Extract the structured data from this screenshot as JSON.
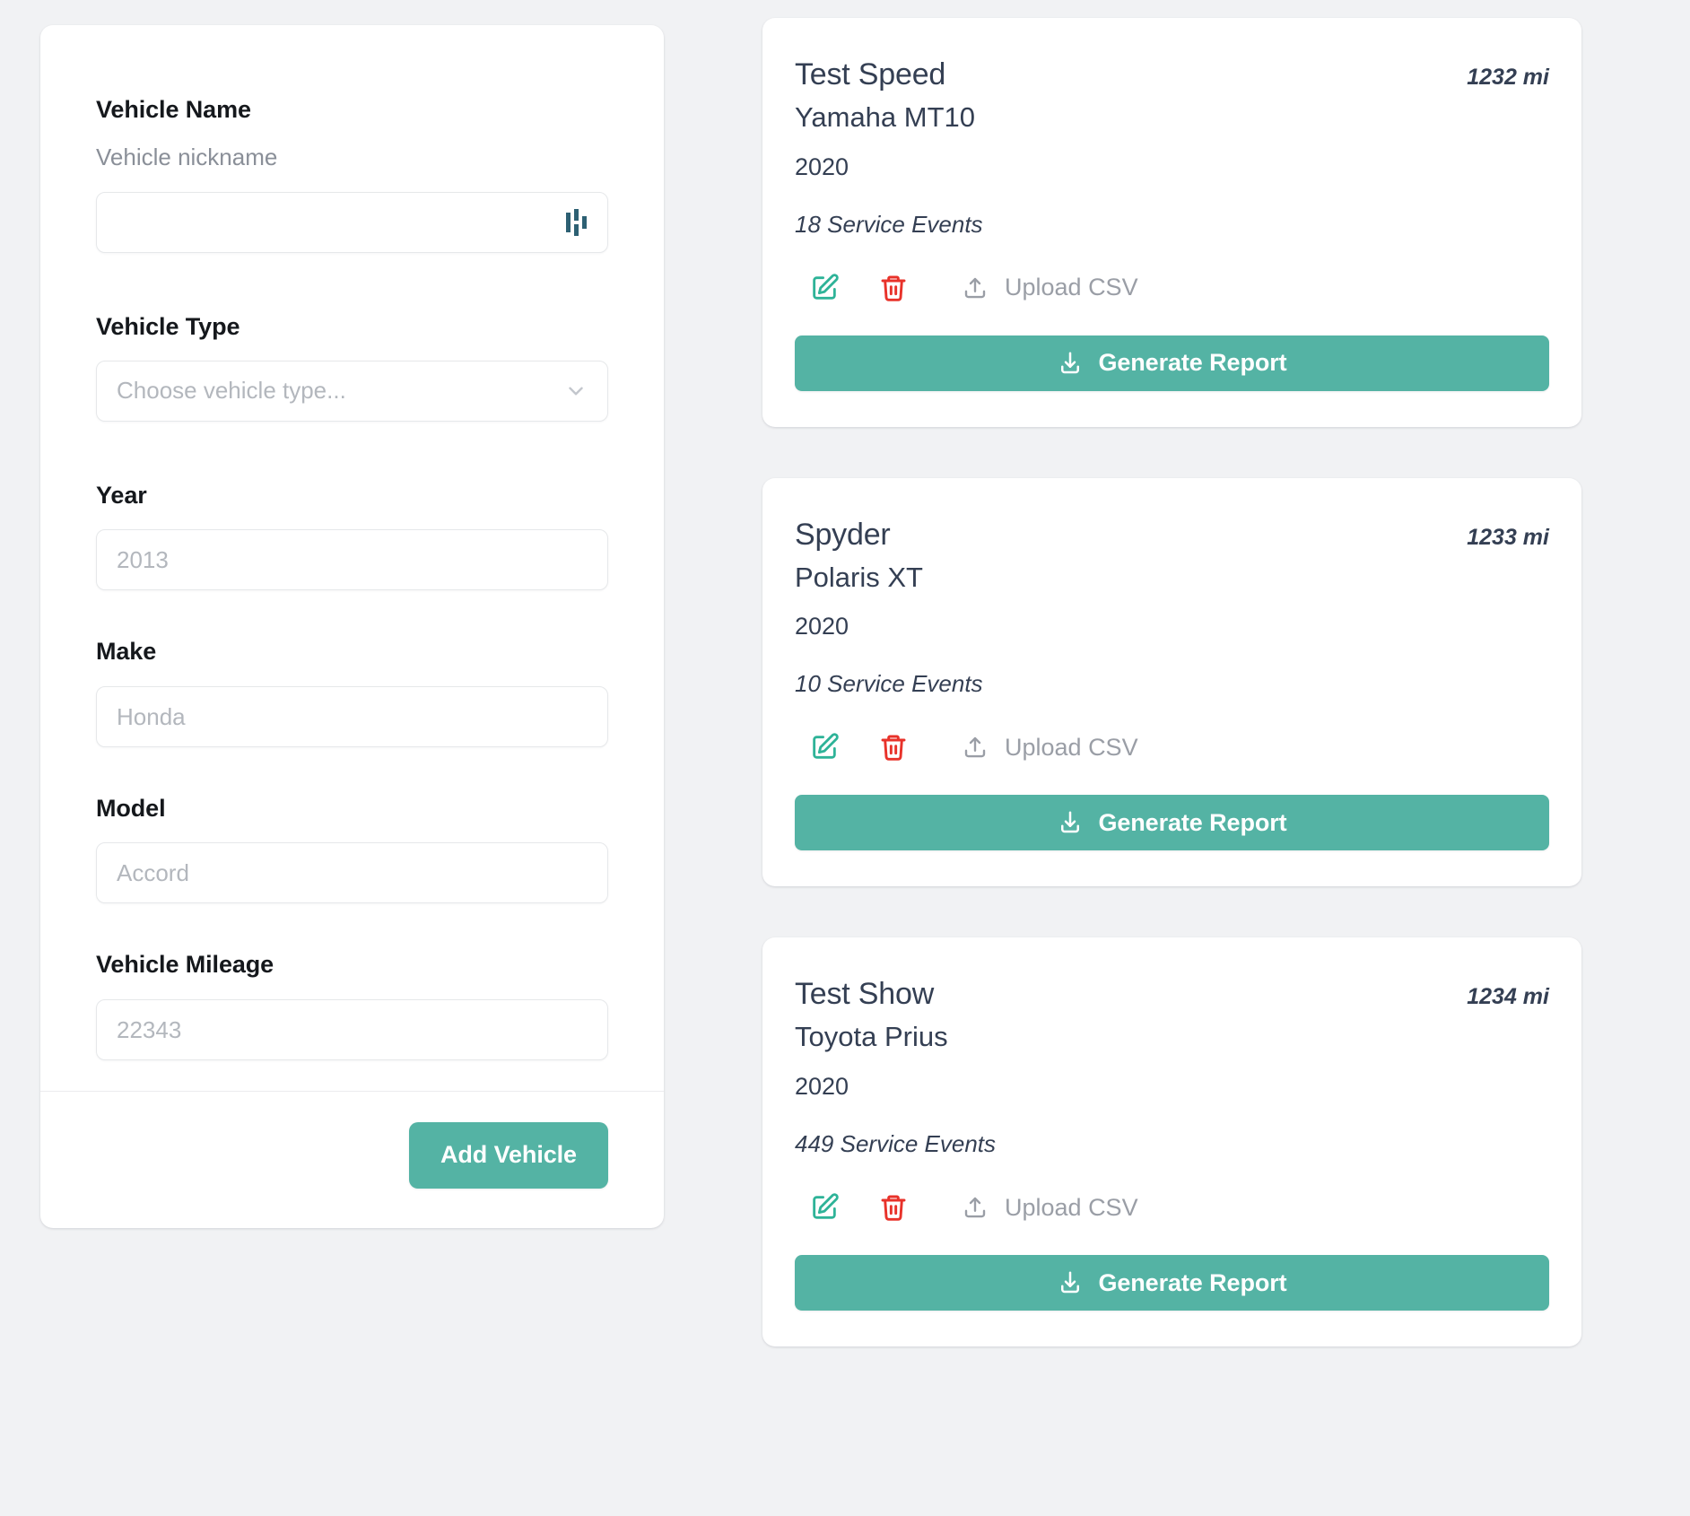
{
  "theme": {
    "background": "#f1f2f4",
    "card_background": "#ffffff",
    "accent_teal": "#54b3a4",
    "danger_red": "#e8322a",
    "edit_green": "#2eb398",
    "text_dark": "#343f53",
    "label_dark": "#15181c",
    "placeholder_gray": "#b3b7bd",
    "muted_gray": "#9a9ea6",
    "name_glyph_color": "#2d6073"
  },
  "form": {
    "vehicle_name": {
      "label": "Vehicle Name",
      "sublabel": "Vehicle nickname",
      "value": "",
      "placeholder": "",
      "glyph": "bars-icon"
    },
    "vehicle_type": {
      "label": "Vehicle Type",
      "placeholder": "Choose vehicle type...",
      "value": "",
      "chevron": "chevron-down-icon"
    },
    "year": {
      "label": "Year",
      "placeholder": "2013",
      "value": ""
    },
    "make": {
      "label": "Make",
      "placeholder": "Honda",
      "value": ""
    },
    "model": {
      "label": "Model",
      "placeholder": "Accord",
      "value": ""
    },
    "mileage": {
      "label": "Vehicle Mileage",
      "placeholder": "22343",
      "value": ""
    },
    "submit_label": "Add Vehicle"
  },
  "common": {
    "upload_label": "Upload CSV",
    "report_label": "Generate Report",
    "edit_icon": "edit-pencil-icon",
    "delete_icon": "trash-icon",
    "upload_icon": "upload-icon",
    "report_icon": "download-icon"
  },
  "vehicles": [
    {
      "name": "Test Speed",
      "make_model": "Yamaha MT10",
      "year": "2020",
      "mileage": "1232 mi",
      "service_events": "18 Service Events",
      "upload_label": "Upload CSV",
      "report_label": "Generate Report"
    },
    {
      "name": "Spyder",
      "make_model": "Polaris XT",
      "year": "2020",
      "mileage": "1233 mi",
      "service_events": "10 Service Events",
      "upload_label": "Upload CSV",
      "report_label": "Generate Report"
    },
    {
      "name": "Test Show",
      "make_model": "Toyota Prius",
      "year": "2020",
      "mileage": "1234 mi",
      "service_events": "449 Service Events",
      "upload_label": "Upload CSV",
      "report_label": "Generate Report"
    }
  ]
}
